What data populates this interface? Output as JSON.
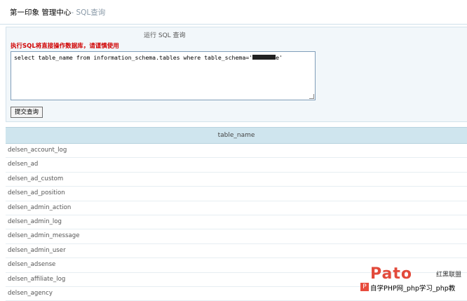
{
  "header": {
    "title_main": "第一印象 管理中心",
    "title_sub": "- SQL查询"
  },
  "form": {
    "run_title": "运行 SQL 查询",
    "warning": "执行SQL将直接操作数据库，请谨慎使用",
    "sql_before": "select table_name from information_schema.tables where table_schema='",
    "sql_after": "e'",
    "submit_label": "提交查询"
  },
  "results": {
    "column": "table_name",
    "rows": [
      "delsen_account_log",
      "delsen_ad",
      "delsen_ad_custom",
      "delsen_ad_position",
      "delsen_admin_action",
      "delsen_admin_log",
      "delsen_admin_message",
      "delsen_admin_user",
      "delsen_adsense",
      "delsen_affiliate_log",
      "delsen_agency"
    ]
  },
  "watermark": {
    "logo": "Pato",
    "brand_cn": "红黑联盟",
    "badge": "P",
    "text": "自学PHP网_php学习_php教"
  }
}
